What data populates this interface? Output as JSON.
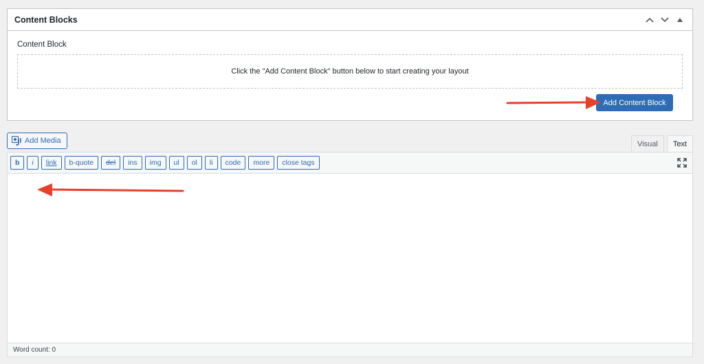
{
  "metabox": {
    "title": "Content Blocks",
    "field_label": "Content Block",
    "empty_message": "Click the \"Add Content Block\" button below to start creating your layout",
    "add_button_label": "Add Content Block"
  },
  "editor": {
    "add_media_label": "Add Media",
    "tabs": [
      {
        "label": "Visual",
        "active": false
      },
      {
        "label": "Text",
        "active": true
      }
    ],
    "quicktags": [
      "b",
      "i",
      "link",
      "b-quote",
      "del",
      "ins",
      "img",
      "ul",
      "ol",
      "li",
      "code",
      "more",
      "close tags"
    ],
    "content": "",
    "word_count_label": "Word count: 0"
  },
  "colors": {
    "primary_blue": "#2e6db5",
    "annotation_red": "#e8402c"
  }
}
